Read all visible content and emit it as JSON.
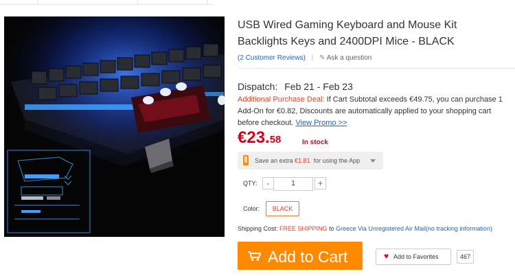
{
  "product": {
    "title": "USB Wired Gaming Keyboard and Mouse Kit Backlights Keys and 2400DPI Mice -  BLACK",
    "reviews_link": "(2 Customer Reviews)",
    "ask_question": "Ask a question"
  },
  "dispatch": {
    "label": "Dispatch:",
    "dates": "Feb 21 - Feb 23"
  },
  "deal": {
    "label": "Additional Purchase Deal:",
    "text": " If Cart Subtotal exceeds €49.75, you can purchase 1 Add-On for €0.82, Discounts are automatically applied to your shopping cart before checkout. ",
    "link": "View Promo >>"
  },
  "price": {
    "main": "€23.",
    "cents": "58",
    "stock": "In stock"
  },
  "app_offer": {
    "prefix": "Save an extra ",
    "amount": "€1.81",
    "suffix": "  for using the App",
    "icon": "phone-icon"
  },
  "quantity": {
    "label": "QTY:",
    "value": "1",
    "minus": "-",
    "plus": "+"
  },
  "color": {
    "label": "Color:",
    "selected": "BLACK"
  },
  "shipping": {
    "label": "Shipping Cost: ",
    "free": "FREE SHIPPING",
    "to": " to ",
    "destination": "Greece Via Unregistered Air Mail(no tracking information)"
  },
  "actions": {
    "add_to_cart": "Add to Cart",
    "add_to_favorites": "Add to Favorites",
    "favorites_count": "467"
  },
  "colors": {
    "accent_orange": "#ff8a00",
    "price_red": "#d0011b",
    "link_blue": "#1d66b5"
  }
}
